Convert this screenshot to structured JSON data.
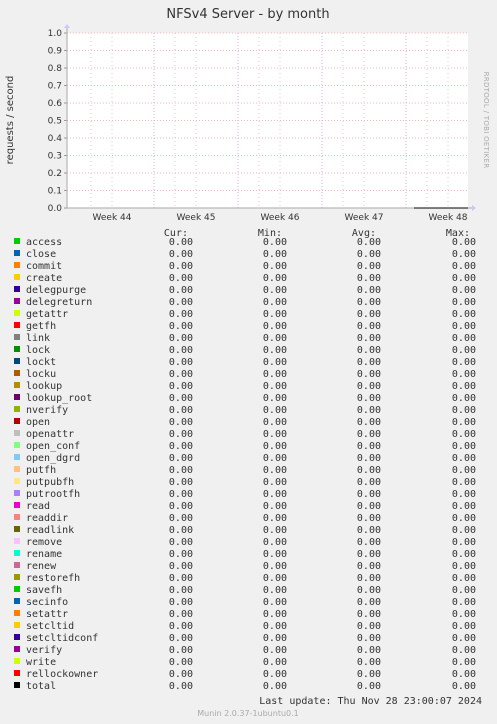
{
  "title": "NFSv4 Server - by month",
  "ylabel": "requests / second",
  "side_label": "RRDTOOL / TOBI OETIKER",
  "headers": {
    "cur": "Cur:",
    "min": "Min:",
    "avg": "Avg:",
    "max": "Max:"
  },
  "footer": {
    "last_update": "Last update: Thu Nov 28 23:00:07 2024",
    "version": "Munin 2.0.37-1ubuntu0.1"
  },
  "chart_data": {
    "type": "line",
    "title": "NFSv4 Server - by month",
    "ylabel": "requests / second",
    "xlabel": "",
    "ylim": [
      0,
      1.0
    ],
    "y_ticks": [
      "0.0",
      "0.1",
      "0.2",
      "0.3",
      "0.4",
      "0.5",
      "0.6",
      "0.7",
      "0.8",
      "0.9",
      "1.0"
    ],
    "x_ticks": [
      "Week 44",
      "Week 45",
      "Week 46",
      "Week 47",
      "Week 48"
    ],
    "grid": true,
    "series": [
      {
        "name": "access",
        "color": "#00cc00",
        "cur": "0.00",
        "min": "0.00",
        "avg": "0.00",
        "max": "0.00"
      },
      {
        "name": "close",
        "color": "#0066b3",
        "cur": "0.00",
        "min": "0.00",
        "avg": "0.00",
        "max": "0.00"
      },
      {
        "name": "commit",
        "color": "#ff8000",
        "cur": "0.00",
        "min": "0.00",
        "avg": "0.00",
        "max": "0.00"
      },
      {
        "name": "create",
        "color": "#ffcc00",
        "cur": "0.00",
        "min": "0.00",
        "avg": "0.00",
        "max": "0.00"
      },
      {
        "name": "delegpurge",
        "color": "#330099",
        "cur": "0.00",
        "min": "0.00",
        "avg": "0.00",
        "max": "0.00"
      },
      {
        "name": "delegreturn",
        "color": "#990099",
        "cur": "0.00",
        "min": "0.00",
        "avg": "0.00",
        "max": "0.00"
      },
      {
        "name": "getattr",
        "color": "#ccff00",
        "cur": "0.00",
        "min": "0.00",
        "avg": "0.00",
        "max": "0.00"
      },
      {
        "name": "getfh",
        "color": "#ff0000",
        "cur": "0.00",
        "min": "0.00",
        "avg": "0.00",
        "max": "0.00"
      },
      {
        "name": "link",
        "color": "#808080",
        "cur": "0.00",
        "min": "0.00",
        "avg": "0.00",
        "max": "0.00"
      },
      {
        "name": "lock",
        "color": "#008f00",
        "cur": "0.00",
        "min": "0.00",
        "avg": "0.00",
        "max": "0.00"
      },
      {
        "name": "lockt",
        "color": "#00487d",
        "cur": "0.00",
        "min": "0.00",
        "avg": "0.00",
        "max": "0.00"
      },
      {
        "name": "locku",
        "color": "#b35a00",
        "cur": "0.00",
        "min": "0.00",
        "avg": "0.00",
        "max": "0.00"
      },
      {
        "name": "lookup",
        "color": "#b38f00",
        "cur": "0.00",
        "min": "0.00",
        "avg": "0.00",
        "max": "0.00"
      },
      {
        "name": "lookup_root",
        "color": "#6b006b",
        "cur": "0.00",
        "min": "0.00",
        "avg": "0.00",
        "max": "0.00"
      },
      {
        "name": "nverify",
        "color": "#8fb300",
        "cur": "0.00",
        "min": "0.00",
        "avg": "0.00",
        "max": "0.00"
      },
      {
        "name": "open",
        "color": "#b30000",
        "cur": "0.00",
        "min": "0.00",
        "avg": "0.00",
        "max": "0.00"
      },
      {
        "name": "openattr",
        "color": "#bebebe",
        "cur": "0.00",
        "min": "0.00",
        "avg": "0.00",
        "max": "0.00"
      },
      {
        "name": "open_conf",
        "color": "#80ff80",
        "cur": "0.00",
        "min": "0.00",
        "avg": "0.00",
        "max": "0.00"
      },
      {
        "name": "open_dgrd",
        "color": "#80c9ff",
        "cur": "0.00",
        "min": "0.00",
        "avg": "0.00",
        "max": "0.00"
      },
      {
        "name": "putfh",
        "color": "#ffc080",
        "cur": "0.00",
        "min": "0.00",
        "avg": "0.00",
        "max": "0.00"
      },
      {
        "name": "putpubfh",
        "color": "#ffe680",
        "cur": "0.00",
        "min": "0.00",
        "avg": "0.00",
        "max": "0.00"
      },
      {
        "name": "putrootfh",
        "color": "#aa80ff",
        "cur": "0.00",
        "min": "0.00",
        "avg": "0.00",
        "max": "0.00"
      },
      {
        "name": "read",
        "color": "#ee00cc",
        "cur": "0.00",
        "min": "0.00",
        "avg": "0.00",
        "max": "0.00"
      },
      {
        "name": "readdir",
        "color": "#ff8080",
        "cur": "0.00",
        "min": "0.00",
        "avg": "0.00",
        "max": "0.00"
      },
      {
        "name": "readlink",
        "color": "#666600",
        "cur": "0.00",
        "min": "0.00",
        "avg": "0.00",
        "max": "0.00"
      },
      {
        "name": "remove",
        "color": "#ffbfff",
        "cur": "0.00",
        "min": "0.00",
        "avg": "0.00",
        "max": "0.00"
      },
      {
        "name": "rename",
        "color": "#00ffcc",
        "cur": "0.00",
        "min": "0.00",
        "avg": "0.00",
        "max": "0.00"
      },
      {
        "name": "renew",
        "color": "#cc6699",
        "cur": "0.00",
        "min": "0.00",
        "avg": "0.00",
        "max": "0.00"
      },
      {
        "name": "restorefh",
        "color": "#999900",
        "cur": "0.00",
        "min": "0.00",
        "avg": "0.00",
        "max": "0.00"
      },
      {
        "name": "savefh",
        "color": "#00cc00",
        "cur": "0.00",
        "min": "0.00",
        "avg": "0.00",
        "max": "0.00"
      },
      {
        "name": "secinfo",
        "color": "#0066b3",
        "cur": "0.00",
        "min": "0.00",
        "avg": "0.00",
        "max": "0.00"
      },
      {
        "name": "setattr",
        "color": "#ff8000",
        "cur": "0.00",
        "min": "0.00",
        "avg": "0.00",
        "max": "0.00"
      },
      {
        "name": "setcltid",
        "color": "#ffcc00",
        "cur": "0.00",
        "min": "0.00",
        "avg": "0.00",
        "max": "0.00"
      },
      {
        "name": "setcltidconf",
        "color": "#330099",
        "cur": "0.00",
        "min": "0.00",
        "avg": "0.00",
        "max": "0.00"
      },
      {
        "name": "verify",
        "color": "#990099",
        "cur": "0.00",
        "min": "0.00",
        "avg": "0.00",
        "max": "0.00"
      },
      {
        "name": "write",
        "color": "#ccff00",
        "cur": "0.00",
        "min": "0.00",
        "avg": "0.00",
        "max": "0.00"
      },
      {
        "name": "rellockowner",
        "color": "#ff0000",
        "cur": "0.00",
        "min": "0.00",
        "avg": "0.00",
        "max": "0.00"
      },
      {
        "name": "total",
        "color": "#000000",
        "cur": "0.00",
        "min": "0.00",
        "avg": "0.00",
        "max": "0.00"
      }
    ]
  }
}
